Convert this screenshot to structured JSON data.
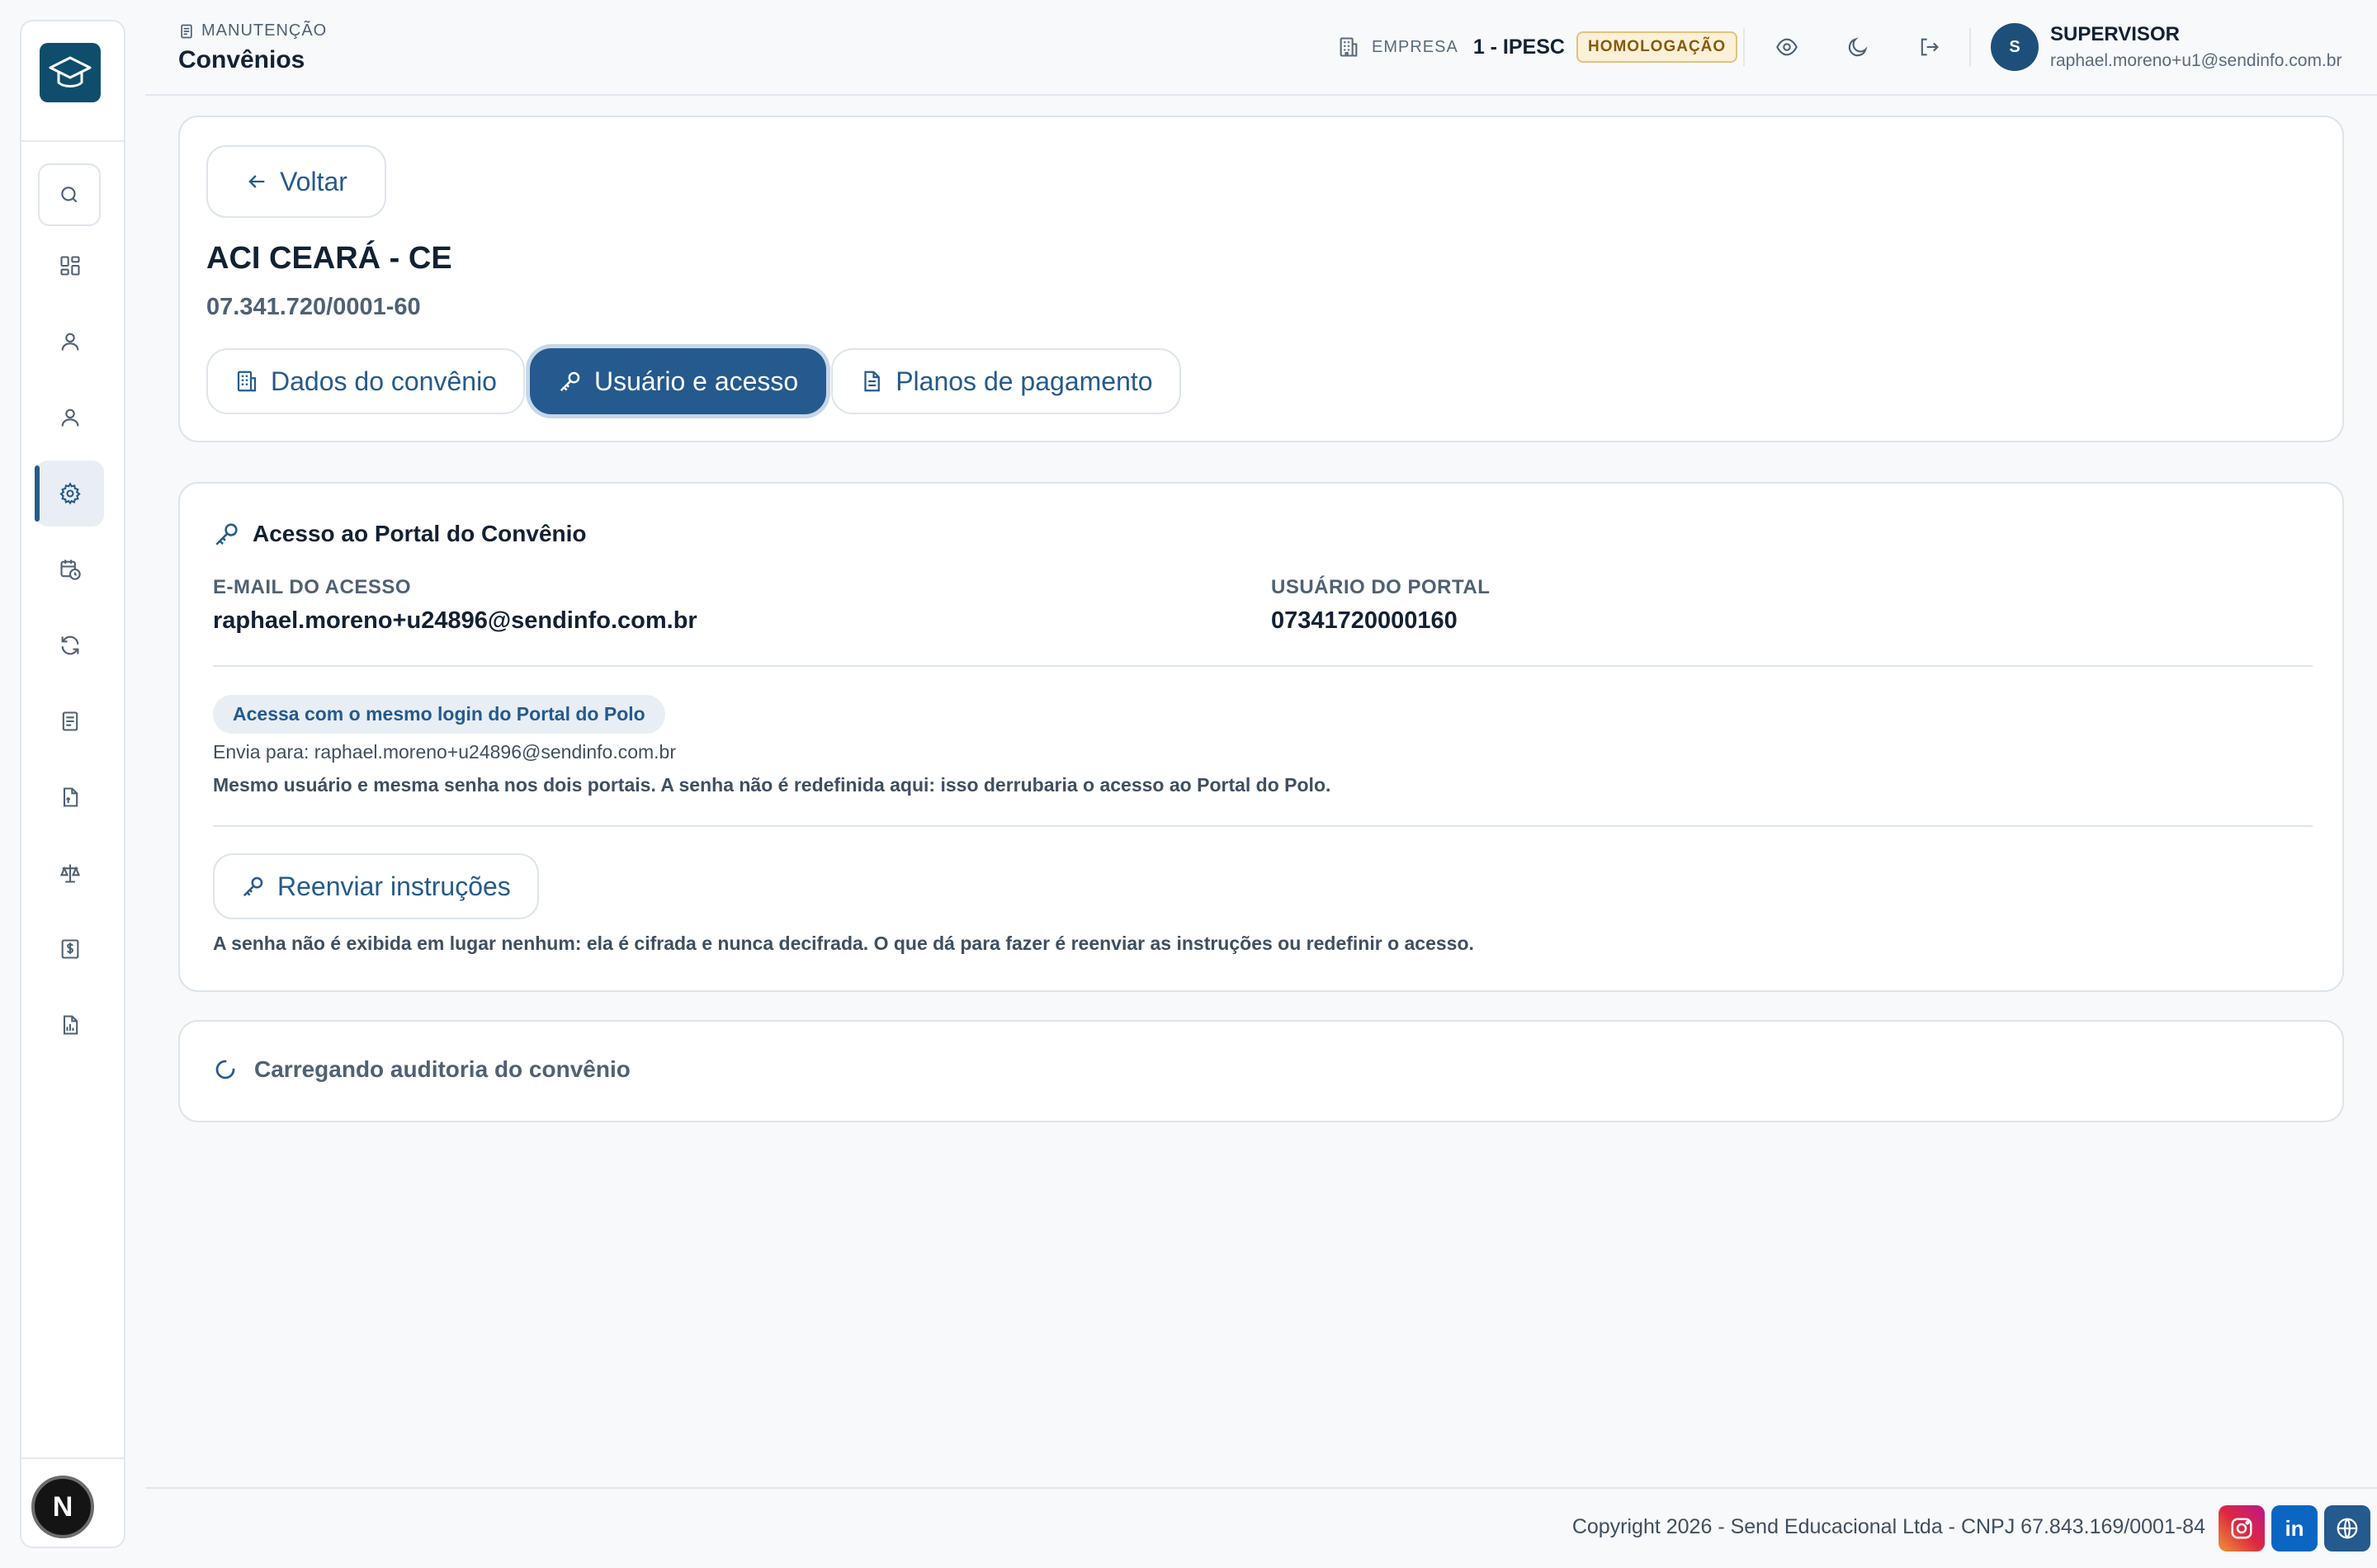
{
  "header": {
    "breadcrumb": "MANUTENÇÃO",
    "title": "Convênios",
    "company_label": "EMPRESA",
    "company_name": "1 - IPESC",
    "environment_badge": "HOMOLOGAÇÃO",
    "user_initial": "S",
    "user_role": "SUPERVISOR",
    "user_email": "raphael.moreno+u1@sendinfo.com.br"
  },
  "sidebar": {
    "items": [
      {
        "icon": "search-icon",
        "active": false
      },
      {
        "icon": "dashboard-icon",
        "active": false
      },
      {
        "icon": "user-icon",
        "active": false
      },
      {
        "icon": "user-icon",
        "active": false
      },
      {
        "icon": "gear-icon",
        "active": true
      },
      {
        "icon": "calendar-clock-icon",
        "active": false
      },
      {
        "icon": "refresh-icon",
        "active": false
      },
      {
        "icon": "document-icon",
        "active": false
      },
      {
        "icon": "file-icon",
        "active": false
      },
      {
        "icon": "scale-icon",
        "active": false
      },
      {
        "icon": "dollar-icon",
        "active": false
      },
      {
        "icon": "report-icon",
        "active": false
      }
    ],
    "bottom_badge": "N"
  },
  "detail": {
    "back_label": "Voltar",
    "entity_name": "ACI CEARÁ - CE",
    "entity_doc": "07.341.720/0001-60",
    "tabs": [
      {
        "label": "Dados do convênio",
        "active": false
      },
      {
        "label": "Usuário e acesso",
        "active": true
      },
      {
        "label": "Planos de pagamento",
        "active": false
      }
    ]
  },
  "access": {
    "title": "Acesso ao Portal do Convênio",
    "email_label": "E-MAIL DO ACESSO",
    "email_value": "raphael.moreno+u24896@sendinfo.com.br",
    "user_label": "USUÁRIO DO PORTAL",
    "user_value": "07341720000160",
    "info_pill": "Acessa com o mesmo login do Portal do Polo",
    "sent_to": "Envia para: raphael.moreno+u24896@sendinfo.com.br",
    "note": "Mesmo usuário e mesma senha nos dois portais. A senha não é redefinida aqui: isso derrubaria o acesso ao Portal do Polo.",
    "resend_label": "Reenviar instruções",
    "password_note": "A senha não é exibida em lugar nenhum: ela é cifrada e nunca decifrada. O que dá para fazer é reenviar as instruções ou redefinir o acesso."
  },
  "audit": {
    "loading_text": "Carregando auditoria do convênio"
  },
  "footer": {
    "copyright": "Copyright 2026 - Send Educacional Ltda - CNPJ 67.843.169/0001-84",
    "social": [
      "instagram-icon",
      "linkedin-icon",
      "globe-icon"
    ],
    "linkedin_glyph": "in"
  },
  "colors": {
    "primary": "#245a8e",
    "logo_bg": "#0f4d6d",
    "badge_bg": "#fbf1d9",
    "badge_text": "#8a5a07"
  }
}
